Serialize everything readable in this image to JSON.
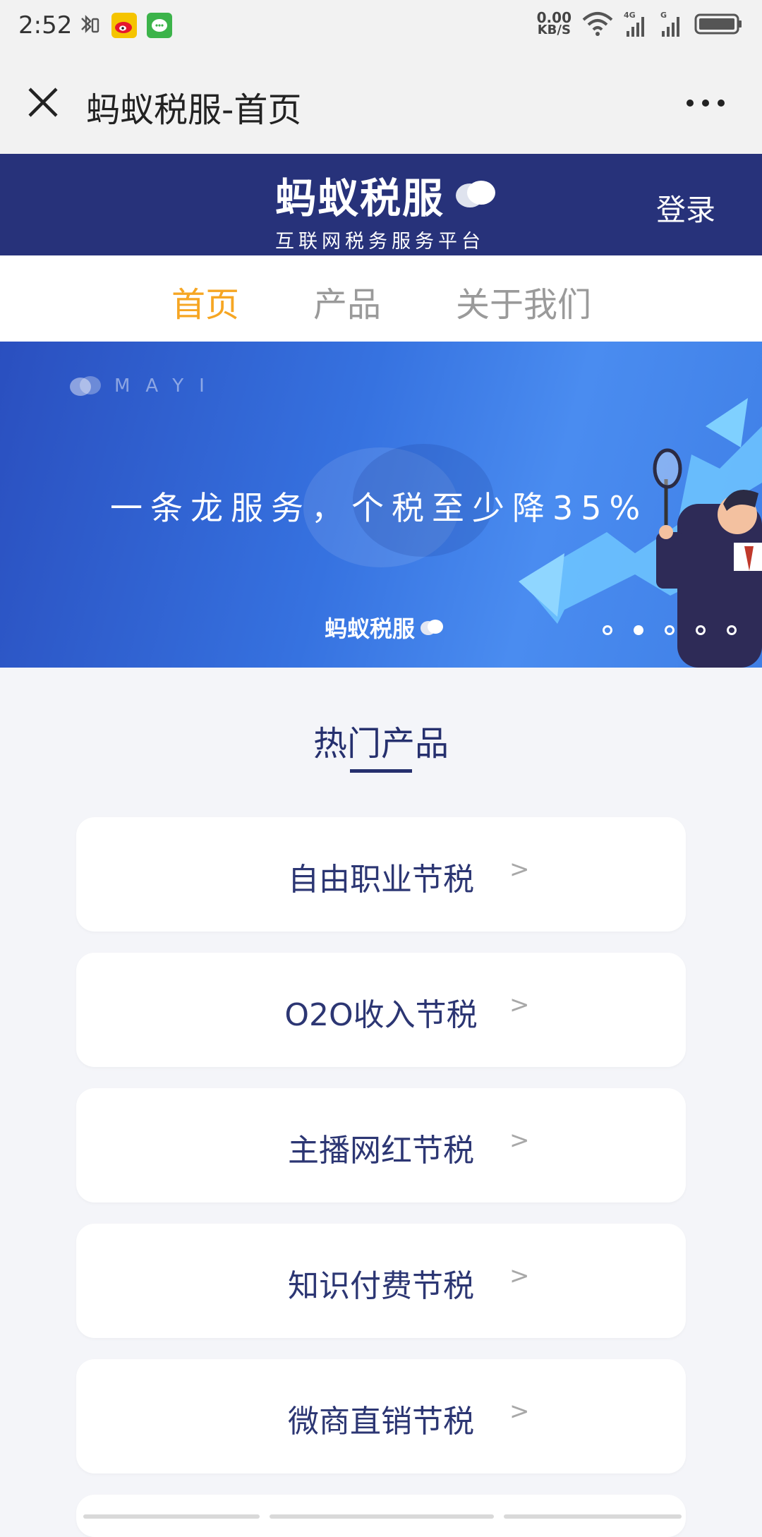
{
  "status_bar": {
    "time": "2:52",
    "net_speed_value": "0.00",
    "net_speed_unit": "KB/S",
    "icons": [
      "bluetooth-vibrate-icon",
      "weibo-icon",
      "wechat-icon",
      "wifi-icon",
      "signal-4g-icon",
      "signal-g-icon",
      "battery-icon"
    ]
  },
  "titlebar": {
    "title": "蚂蚁税服-首页"
  },
  "brand": {
    "name": "蚂蚁税服",
    "subtitle": "互联网税务服务平台",
    "login_label": "登录"
  },
  "nav": {
    "tabs": [
      {
        "label": "首页",
        "active": true
      },
      {
        "label": "产品",
        "active": false
      },
      {
        "label": "关于我们",
        "active": false
      }
    ]
  },
  "banner": {
    "mayi_text": "MAYI",
    "slogan": "一条龙服务，个税至少降35%",
    "brand": "蚂蚁税服",
    "slide_count": 5,
    "active_slide_index": 1
  },
  "hot_products": {
    "title": "热门产品",
    "arrow": ">",
    "items": [
      {
        "label": "自由职业节税"
      },
      {
        "label": "O2O收入节税"
      },
      {
        "label": "主播网红节税"
      },
      {
        "label": "知识付费节税"
      },
      {
        "label": "微商直销节税"
      }
    ]
  },
  "colors": {
    "brand_navy": "#27327a",
    "nav_active": "#f6a623",
    "product_text": "#2c3673",
    "banner_blue": "#3672e0"
  }
}
